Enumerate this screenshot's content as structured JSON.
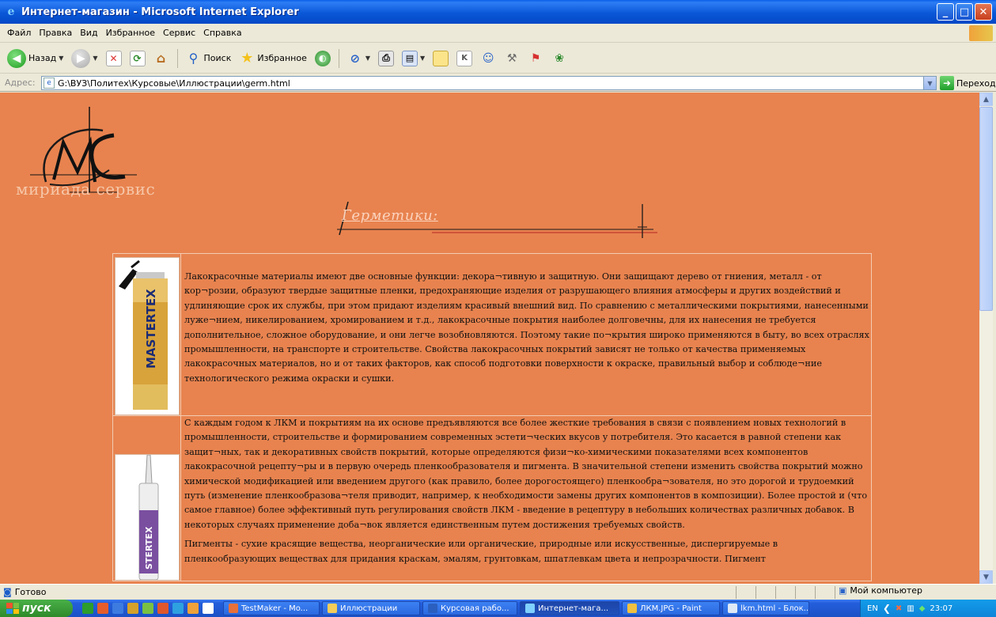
{
  "window": {
    "title": "Интернет-магазин - Microsoft Internet Explorer",
    "controls": [
      "_",
      "□",
      "✕"
    ]
  },
  "menu": [
    "Файл",
    "Правка",
    "Вид",
    "Избранное",
    "Сервис",
    "Справка"
  ],
  "toolbar": {
    "back_label": "Назад",
    "search_label": "Поиск",
    "favorites_label": "Избранное"
  },
  "address": {
    "label": "Адрес:",
    "value": "G:\\ВУЗ\\Политех\\Курсовые\\Иллюстрации\\germ.html",
    "go_label": "Переход"
  },
  "page": {
    "logo_text": "мириада сервис",
    "heading": "Герметики:",
    "rows": [
      {
        "image_label": "MASTERTEX",
        "text": "Лакокрасочные материалы имеют две основные функции: декора¬тивную и защитную. Они защищают дерево от гниения, металл - от кор¬розии, образуют твердые защитные пленки, предохраняющие изделия от разрушающего влияния атмосферы и других воздействий и удлиняющие срок их службы, при этом придают изделиям красивый внешний вид. По сравнению с металлическими покрытиями, нанесенными луже¬нием, никелированием, хромированием и т.д., лакокрасочные покрытия наиболее долговечны, для их нанесения не требуется дополнительное, сложное оборудование, и они легче возобновляются. Поэтому такие по¬крытия широко применяются в быту, во всех отраслях промышленности, на транспорте и строительстве. Свойства лакокрасочных покрытий зависят не только от качества применяемых лакокрасочных материалов, но и от таких факторов, как способ подготовки поверхности к окраске, правильный выбор и соблюде¬ние технологического режима окраски и сушки."
      },
      {
        "image_label": "STERTEX",
        "text": "С каждым годом к ЛКМ и покрытиям на их основе предъявляются все более жесткие требования в связи с появлением новых технологий в промышленности, строительстве и формированием современных эстети¬ческих вкусов у потребителя. Это касается в равной степени как защит¬ных, так и декоративных свойств покрытий, которые определяются физи¬ко-химическими показателями всех компонентов лакокрасочной рецепту¬ры и в первую очередь пленкообразователя и пигмента. В значительной степени изменить свойства покрытий можно химической модификацией или введением другого (как правило, более дорогостоящего) пленкообра¬зователя, но это дорогой и трудоемкий путь (изменение пленкообразова¬теля приводит, например, к необходимости замены других компонентов в композиции). Более простой и (что самое главное) более эффективный путь регулирования свойств ЛКМ - введение в рецептуру в небольших количествах различных добавок. В некоторых случаях применение доба¬вок является единственным путем достижения требуемых свойств.",
        "text2": "Пигменты - сухие красящие вещества, неорганические или органические, природные или искусственные, диспергируемые в пленкообразующих веществах для придания краскам, эмалям, грунтовкам, шпатлевкам цвета и непрозрачности. Пигмент"
      }
    ]
  },
  "status": {
    "text": "Готово",
    "zone": "Мой компьютер"
  },
  "taskbar": {
    "start": "пуск",
    "tasks": [
      "TestMaker - Mo...",
      "Иллюстрации",
      "Курсовая рабо...",
      "Интернет-мага...",
      "ЛКМ.JPG - Paint",
      "lkm.html - Блок..."
    ],
    "lang": "EN",
    "clock": "23:07"
  },
  "colors": {
    "page_bg": "#e8834f",
    "titlebar": "#0a58d8",
    "taskbar": "#245edb"
  }
}
